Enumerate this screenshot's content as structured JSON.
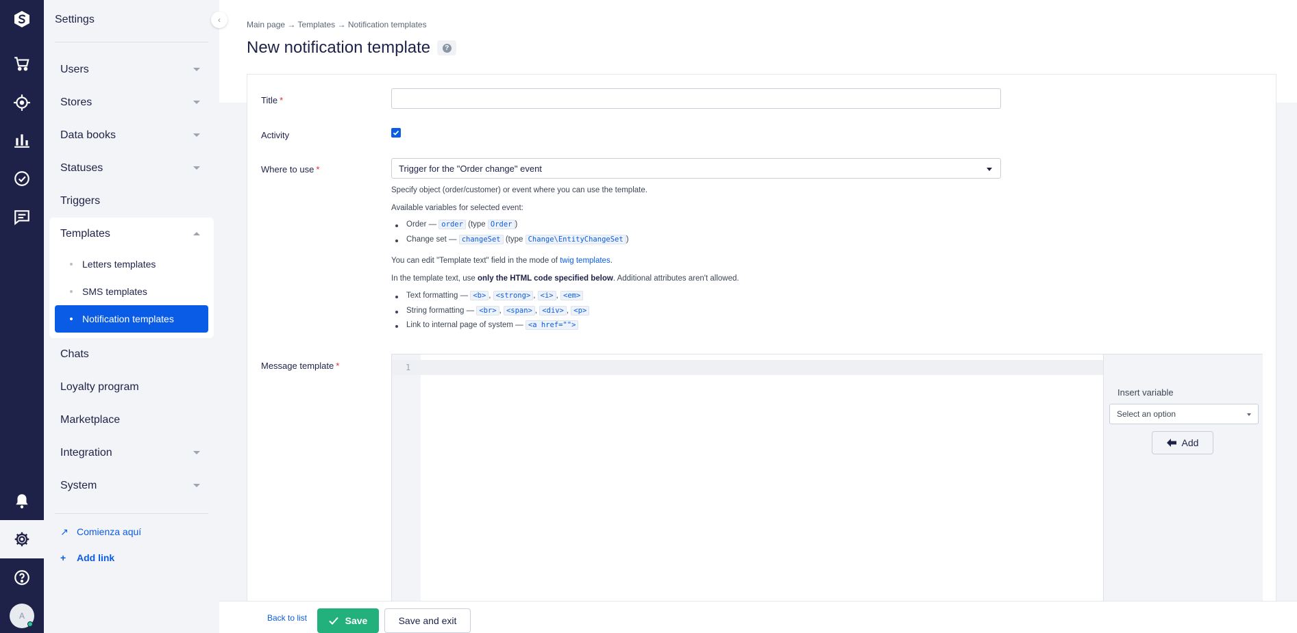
{
  "rail": {
    "icons": [
      "logo-icon",
      "cart-icon",
      "target-icon",
      "bar-chart-icon",
      "check-circle-icon",
      "chat-icon",
      "bell-icon",
      "gear-icon",
      "help-icon"
    ],
    "avatar_initial": "A"
  },
  "sidebar": {
    "heading": "Settings",
    "items": [
      {
        "label": "Users"
      },
      {
        "label": "Stores"
      },
      {
        "label": "Data books"
      },
      {
        "label": "Statuses"
      },
      {
        "label": "Triggers"
      },
      {
        "label": "Templates"
      },
      {
        "label": "Chats"
      },
      {
        "label": "Loyalty program"
      },
      {
        "label": "Marketplace"
      },
      {
        "label": "Integration"
      },
      {
        "label": "System"
      }
    ],
    "subitems": [
      {
        "label": "Letters templates"
      },
      {
        "label": "SMS templates"
      },
      {
        "label": "Notification templates"
      }
    ],
    "links": [
      {
        "label": "Comienza aquí"
      },
      {
        "label": "Add link"
      }
    ]
  },
  "breadcrumb": "Main page → Templates → Notification templates",
  "page_title": "New notification template",
  "help_glyph": "?",
  "form": {
    "title_label": "Title",
    "activity_label": "Activity",
    "where_label": "Where to use",
    "where_value": "Trigger for the \"Order change\" event",
    "hint1": "Specify object (order/customer) or event where you can use the template.",
    "hint2": "Available variables for selected event:",
    "vars": {
      "order_text": "Order —",
      "order_code": "order",
      "type_word": "(type",
      "order_type": "Order",
      "close_paren": ")",
      "change_text": "Change set —",
      "change_code": "changeSet",
      "change_type": "Change\\EntityChangeSet"
    },
    "twig_text": "You can edit \"Template text\" field in the mode of",
    "twig_link": "twig templates",
    "twig_dot": ".",
    "html_pre": "In the template text, use",
    "html_bold": "only the HTML code specified below",
    "html_post": ". Additional attributes aren't allowed.",
    "fmt": {
      "text_label": "Text formatting —",
      "text_codes": [
        "<b>",
        "<strong>",
        "<i>",
        "<em>"
      ],
      "string_label": "String formatting —",
      "string_codes": [
        "<br>",
        "<span>",
        "<div>",
        "<p>"
      ],
      "link_label": "Link to internal page of system —",
      "link_code": "<a href=\"\">"
    },
    "message_label": "Message template",
    "line_number": "1",
    "insert_variable_label": "Insert variable",
    "insert_variable_placeholder": "Select an option",
    "add_button": "Add"
  },
  "footer": {
    "back_link": "Back to list",
    "save": "Save",
    "save_exit": "Save and exit"
  }
}
